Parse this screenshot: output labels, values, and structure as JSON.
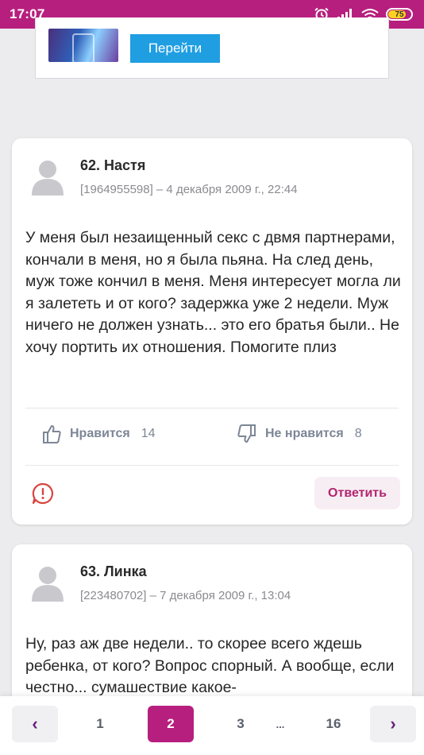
{
  "status_bar": {
    "time": "17:07",
    "battery": "75",
    "icons": [
      "alarm-icon",
      "signal-icon",
      "wifi-icon",
      "battery-icon"
    ]
  },
  "ad": {
    "button_label": "Перейти"
  },
  "comments": [
    {
      "author": "62. Настя",
      "meta": "[1964955598] – 4 декабря 2009 г., 22:44",
      "text": "У меня был незаищенный секс с двмя партнерами, кончали в меня, но я была пьяна. На след день, муж тоже кончил в меня. Меня интересует могла ли я залететь и от кого? задержка уже 2 недели. Муж ничего не должен узнать... это его братья были.. Не хочу портить их отношения. Помогите плиз",
      "like_label": "Нравится",
      "like_count": "14",
      "dislike_label": "Не нравится",
      "dislike_count": "8",
      "reply_label": "Ответить"
    },
    {
      "author": "63. Линка",
      "meta": "[223480702] – 7 декабря 2009 г., 13:04",
      "text": "Ну, раз аж две недели.. то скорее всего ждешь ребенка, от кого? Вопрос спорный. А вообще, если честно... сумашествие какое-"
    }
  ],
  "pagination": {
    "prev": "‹",
    "pages": [
      "1",
      "2",
      "3",
      "...",
      "16"
    ],
    "active": "2",
    "next": "›"
  },
  "colors": {
    "accent": "#b71f7e",
    "ad_button": "#1f9ee2",
    "reaction": "#7d8696"
  }
}
